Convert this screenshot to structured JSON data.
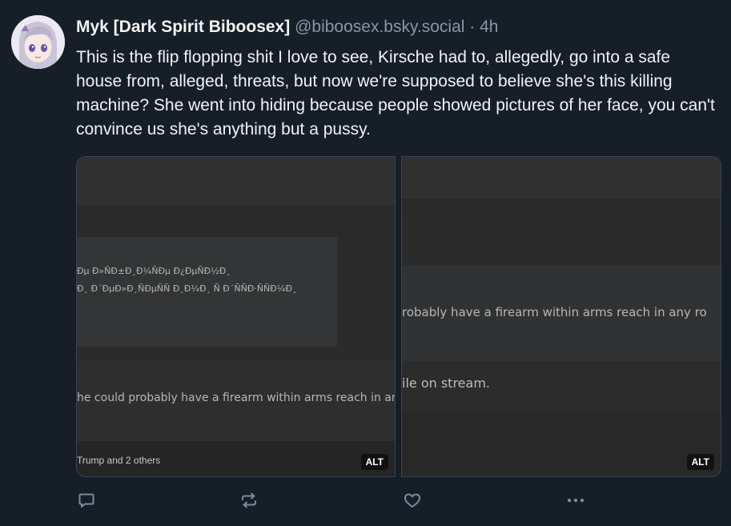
{
  "post": {
    "author_name": "Myk [Dark Spirit Biboosex]",
    "handle": "@biboosex.bsky.social",
    "separator": "·",
    "time": "4h",
    "text": "This is the flip flopping shit I love to see, Kirsche had to, allegedly, go into a safe house from, alleged, threats, but now we're supposed to believe she's this killing machine? She went into hiding because people showed pictures of her face, you can't convince us she's anything but a pussy."
  },
  "images": [
    {
      "garbled_line1": "Ðµ Ð»ÑÐ±Ð¸Ð¼ÑÐµ Ð¿ÐµÑÐ½Ð¸",
      "garbled_line2": "Ð¸ Ð´ÐµÐ»Ð¸ÑÐµÑÑ Ð¸Ð¼Ð¸ Ñ Ð´ÑÑÐ·ÑÑÐ¼Ð¸",
      "caption": "he could probably have a firearm within arms reach in any ro",
      "footer": "Trump and 2 others",
      "alt_badge": "ALT"
    },
    {
      "caption": "robably have a firearm within arms reach in any ro",
      "caption2": "ile on stream.",
      "alt_badge": "ALT"
    }
  ],
  "actions": [
    {
      "icon": "reply-icon"
    },
    {
      "icon": "repost-icon"
    },
    {
      "icon": "like-icon"
    },
    {
      "icon": "more-icon"
    }
  ],
  "colors": {
    "background": "#161e27",
    "text": "#f1f3f5",
    "muted": "#8a96a6",
    "icon": "#7d8a9c"
  }
}
